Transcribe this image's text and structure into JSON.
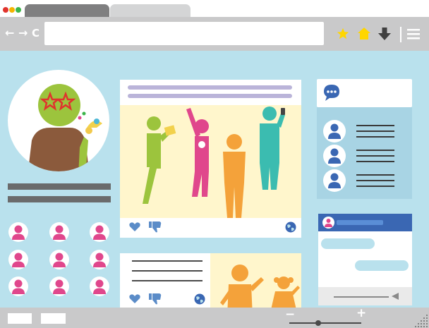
{
  "window": {
    "controls": [
      "close-dot",
      "minimize-dot",
      "maximize-dot"
    ],
    "colors": {
      "close": "#e0332d",
      "minimize": "#f4b400",
      "maximize": "#3cb54a"
    }
  },
  "tabs": [
    {
      "label": "",
      "state": "active"
    },
    {
      "label": "",
      "state": "inactive"
    }
  ],
  "toolbar": {
    "back_glyph": "←",
    "forward_glyph": "→",
    "reload_glyph": "C",
    "address_value": "",
    "icons": [
      "star-icon",
      "home-icon",
      "download-icon",
      "menu-icon"
    ],
    "accent": "#ffd600"
  },
  "profile": {
    "avatar_icon": "person-with-star-glasses-icon",
    "friend_count": 9,
    "friend_icon": "user-icon",
    "friend_color": "#e0478c"
  },
  "post1": {
    "image_subject": "people-dancing",
    "actions": [
      "like-icon",
      "dislike-icon",
      "share-globe-icon"
    ]
  },
  "post2": {
    "image_subject": "adult-and-child-waving",
    "actions": [
      "like-icon",
      "dislike-icon",
      "share-globe-icon"
    ]
  },
  "chat": {
    "header_icon": "chat-bubble-icon",
    "contacts": [
      {
        "icon": "user-icon"
      },
      {
        "icon": "user-icon"
      },
      {
        "icon": "user-icon"
      }
    ],
    "message_window_icon": "user-icon"
  },
  "statusbar": {
    "zoom_minus": "−",
    "zoom_plus": "+",
    "zoom_level": 0.4,
    "colors": {
      "slider": "#4a4a4a"
    }
  }
}
